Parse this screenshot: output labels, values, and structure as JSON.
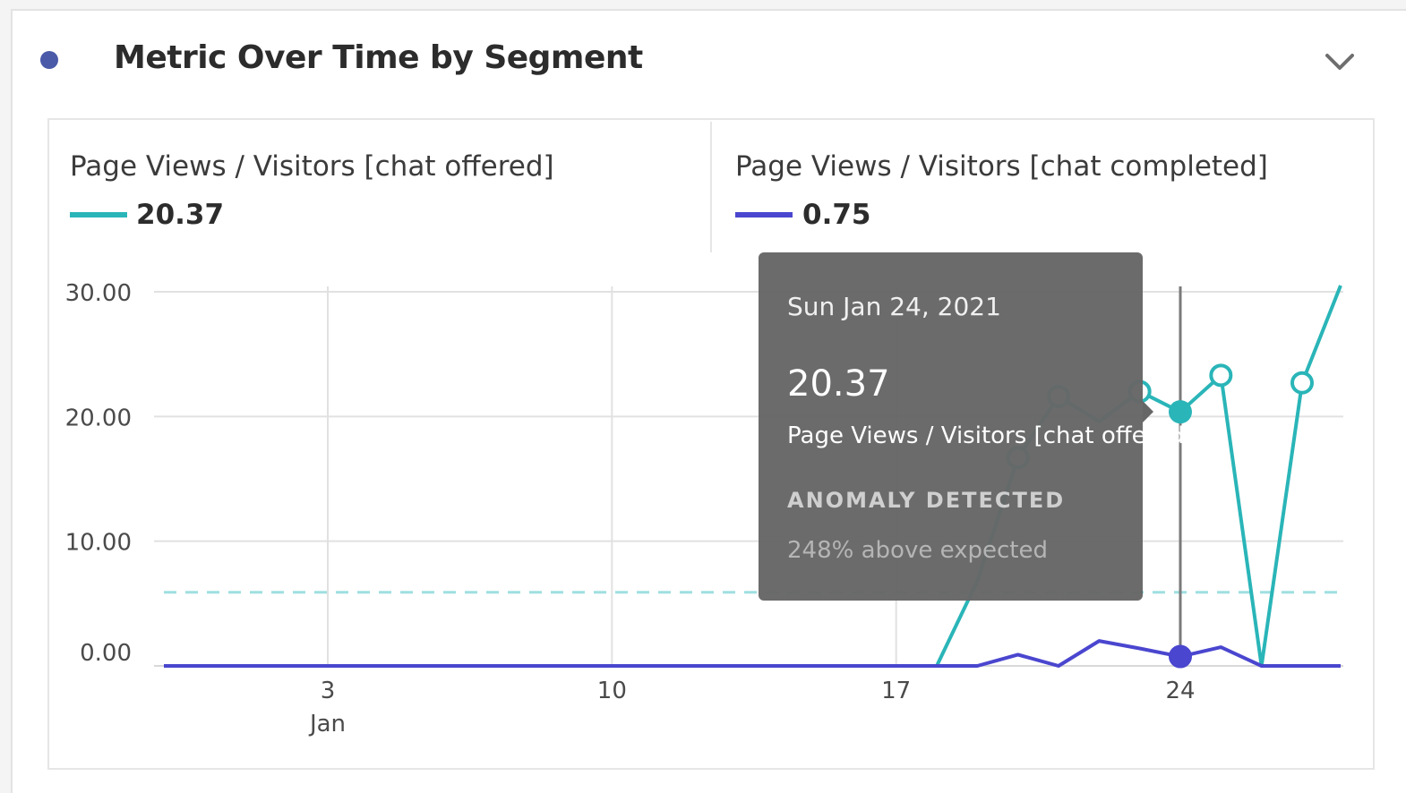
{
  "panel": {
    "title": "Metric Over Time by Segment",
    "status_dot_color": "#4a5aa8",
    "collapse_icon": "chevron-down-icon"
  },
  "legend": [
    {
      "label": "Page Views / Visitors [chat offered]",
      "value": "20.37",
      "color": "#2ab5b8"
    },
    {
      "label": "Page Views / Visitors [chat completed]",
      "value": "0.75",
      "color": "#4a46cf"
    }
  ],
  "tooltip": {
    "date": "Sun Jan 24, 2021",
    "value": "20.37",
    "metric": "Page Views / Visitors [chat offered]",
    "anomaly_label": "ANOMALY DETECTED",
    "expected_text": "248% above expected"
  },
  "chart_data": {
    "type": "line",
    "x_start_day": 1,
    "x_end_day": 30,
    "x_ticks": [
      {
        "day": 3,
        "label": "3",
        "sublabel": "Jan"
      },
      {
        "day": 10,
        "label": "10"
      },
      {
        "day": 17,
        "label": "17"
      },
      {
        "day": 24,
        "label": "24"
      }
    ],
    "y_ticks": [
      "30.00",
      "20.00",
      "10.00",
      "0.00"
    ],
    "ylim": [
      0,
      30
    ],
    "grid": true,
    "series": [
      {
        "name": "Page Views / Visitors [chat offered]",
        "color": "#2ab5b8",
        "x": [
          1,
          2,
          3,
          4,
          5,
          6,
          7,
          8,
          9,
          10,
          11,
          12,
          13,
          14,
          15,
          16,
          17,
          18,
          19,
          20,
          21,
          22,
          23,
          24,
          25,
          26,
          27,
          28,
          29,
          30
        ],
        "y": [
          0,
          0,
          0,
          0,
          0,
          0,
          0,
          0,
          0,
          0,
          0,
          0,
          0,
          0,
          0,
          0,
          0,
          0,
          6.8,
          16.7,
          21.6,
          19.6,
          22.0,
          20.37,
          23.3,
          0,
          22.7,
          30.5,
          null,
          null
        ],
        "hollow_markers_at": [
          20,
          21,
          23,
          25,
          27
        ],
        "selected_at": 24
      },
      {
        "name": "Page Views / Visitors [chat completed]",
        "color": "#4a46cf",
        "x": [
          1,
          2,
          3,
          4,
          5,
          6,
          7,
          8,
          9,
          10,
          11,
          12,
          13,
          14,
          15,
          16,
          17,
          18,
          19,
          20,
          21,
          22,
          23,
          24,
          25,
          26,
          27,
          28,
          29,
          30
        ],
        "y": [
          0,
          0,
          0,
          0,
          0,
          0,
          0,
          0,
          0,
          0,
          0,
          0,
          0,
          0,
          0,
          0,
          0,
          0,
          0,
          0.9,
          0,
          2.0,
          1.4,
          0.75,
          1.5,
          0,
          0,
          0,
          null,
          null
        ],
        "selected_at": 24
      }
    ],
    "expected_band": {
      "value": 5.9,
      "color": "#9fdfe1"
    },
    "selected_day": 24
  }
}
